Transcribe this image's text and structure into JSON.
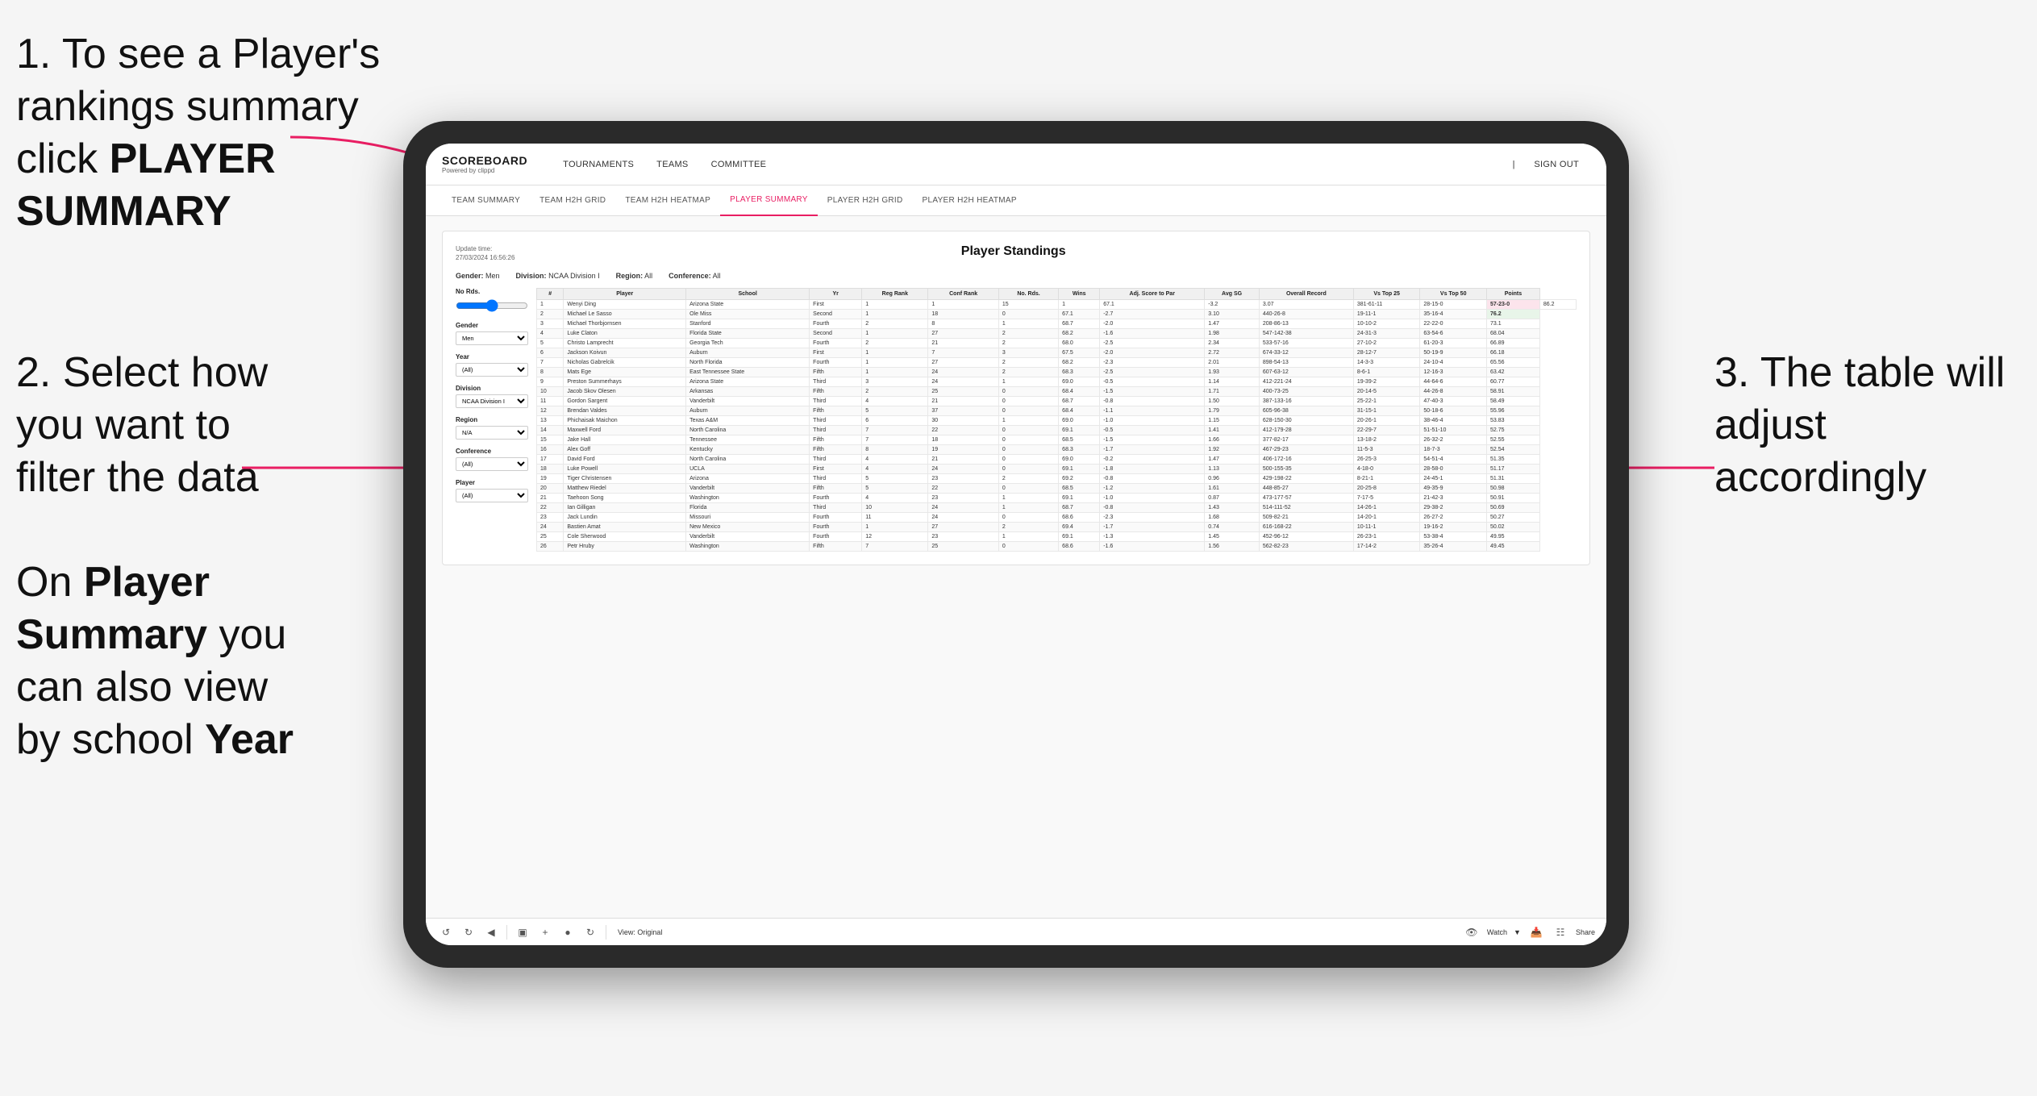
{
  "instructions": {
    "step1": "1. To see a Player's rankings summary click ",
    "step1_bold": "PLAYER SUMMARY",
    "step2_title": "2. Select how you want to filter the data",
    "step3_title": "3. The table will adjust accordingly",
    "bottom_note": "On ",
    "bottom_bold1": "Player Summary",
    "bottom_mid": " you can also view by school ",
    "bottom_bold2": "Year"
  },
  "nav": {
    "logo": "SCOREBOARD",
    "logo_sub": "Powered by clippd",
    "items": [
      "TOURNAMENTS",
      "TEAMS",
      "COMMITTEE"
    ],
    "right": [
      "Sign out"
    ]
  },
  "sub_nav": {
    "items": [
      "TEAM SUMMARY",
      "TEAM H2H GRID",
      "TEAM H2H HEATMAP",
      "PLAYER SUMMARY",
      "PLAYER H2H GRID",
      "PLAYER H2H HEATMAP"
    ]
  },
  "card": {
    "title": "Player Standings",
    "update_label": "Update time:",
    "update_value": "27/03/2024 16:56:26",
    "filters": {
      "gender_label": "Gender:",
      "gender_value": "Men",
      "division_label": "Division:",
      "division_value": "NCAA Division I",
      "region_label": "Region:",
      "region_value": "All",
      "conference_label": "Conference:",
      "conference_value": "All"
    }
  },
  "sidebar": {
    "no_rds_label": "No Rds.",
    "gender_label": "Gender",
    "gender_value": "Men",
    "year_label": "Year",
    "year_value": "(All)",
    "division_label": "Division",
    "division_value": "NCAA Division I",
    "region_label": "Region",
    "region_value": "N/A",
    "conference_label": "Conference",
    "conference_value": "(All)",
    "player_label": "Player",
    "player_value": "(All)"
  },
  "table": {
    "headers": [
      "#",
      "Player",
      "School",
      "Yr",
      "Reg Rank",
      "Conf Rank",
      "No. Rds.",
      "Wins",
      "Adj. Score to Par",
      "Avg SG",
      "Overall Record",
      "Vs Top 25",
      "Vs Top 50",
      "Points"
    ],
    "rows": [
      [
        "1",
        "Wenyi Ding",
        "Arizona State",
        "First",
        "1",
        "1",
        "15",
        "1",
        "67.1",
        "-3.2",
        "3.07",
        "381-61-11",
        "28-15-0",
        "57-23-0",
        "86.2"
      ],
      [
        "2",
        "Michael Le Sasso",
        "Ole Miss",
        "Second",
        "1",
        "18",
        "0",
        "67.1",
        "-2.7",
        "3.10",
        "440-26-8",
        "19-11-1",
        "35-16-4",
        "76.2"
      ],
      [
        "3",
        "Michael Thorbjornsen",
        "Stanford",
        "Fourth",
        "2",
        "8",
        "1",
        "68.7",
        "-2.0",
        "1.47",
        "208-86-13",
        "10-10-2",
        "22-22-0",
        "73.1"
      ],
      [
        "4",
        "Luke Claton",
        "Florida State",
        "Second",
        "1",
        "27",
        "2",
        "68.2",
        "-1.6",
        "1.98",
        "547-142-38",
        "24-31-3",
        "63-54-6",
        "68.04"
      ],
      [
        "5",
        "Christo Lamprecht",
        "Georgia Tech",
        "Fourth",
        "2",
        "21",
        "2",
        "68.0",
        "-2.5",
        "2.34",
        "533-57-16",
        "27-10-2",
        "61-20-3",
        "66.89"
      ],
      [
        "6",
        "Jackson Koivun",
        "Auburn",
        "First",
        "1",
        "7",
        "3",
        "67.5",
        "-2.0",
        "2.72",
        "674-33-12",
        "28-12-7",
        "50-19-9",
        "66.18"
      ],
      [
        "7",
        "Nicholas Gabrelcik",
        "North Florida",
        "Fourth",
        "1",
        "27",
        "2",
        "68.2",
        "-2.3",
        "2.01",
        "898-54-13",
        "14-3-3",
        "24-10-4",
        "65.56"
      ],
      [
        "8",
        "Mats Ege",
        "East Tennessee State",
        "Fifth",
        "1",
        "24",
        "2",
        "68.3",
        "-2.5",
        "1.93",
        "607-63-12",
        "8-6-1",
        "12-16-3",
        "63.42"
      ],
      [
        "9",
        "Preston Summerhays",
        "Arizona State",
        "Third",
        "3",
        "24",
        "1",
        "69.0",
        "-0.5",
        "1.14",
        "412-221-24",
        "19-39-2",
        "44-64-6",
        "60.77"
      ],
      [
        "10",
        "Jacob Skov Olesen",
        "Arkansas",
        "Fifth",
        "2",
        "25",
        "0",
        "68.4",
        "-1.5",
        "1.71",
        "400-73-25",
        "20-14-5",
        "44-26-8",
        "58.91"
      ],
      [
        "11",
        "Gordon Sargent",
        "Vanderbilt",
        "Third",
        "4",
        "21",
        "0",
        "68.7",
        "-0.8",
        "1.50",
        "387-133-16",
        "25-22-1",
        "47-40-3",
        "58.49"
      ],
      [
        "12",
        "Brendan Valdes",
        "Auburn",
        "Fifth",
        "5",
        "37",
        "0",
        "68.4",
        "-1.1",
        "1.79",
        "605-96-38",
        "31-15-1",
        "50-18-6",
        "55.96"
      ],
      [
        "13",
        "Phichaisak Maichon",
        "Texas A&M",
        "Third",
        "6",
        "30",
        "1",
        "69.0",
        "-1.0",
        "1.15",
        "628-150-30",
        "20-26-1",
        "38-46-4",
        "53.83"
      ],
      [
        "14",
        "Maxwell Ford",
        "North Carolina",
        "Third",
        "7",
        "22",
        "0",
        "69.1",
        "-0.5",
        "1.41",
        "412-179-28",
        "22-29-7",
        "51-51-10",
        "52.75"
      ],
      [
        "15",
        "Jake Hall",
        "Tennessee",
        "Fifth",
        "7",
        "18",
        "0",
        "68.5",
        "-1.5",
        "1.66",
        "377-82-17",
        "13-18-2",
        "26-32-2",
        "52.55"
      ],
      [
        "16",
        "Alex Goff",
        "Kentucky",
        "Fifth",
        "8",
        "19",
        "0",
        "68.3",
        "-1.7",
        "1.92",
        "467-29-23",
        "11-5-3",
        "18-7-3",
        "52.54"
      ],
      [
        "17",
        "David Ford",
        "North Carolina",
        "Third",
        "4",
        "21",
        "0",
        "69.0",
        "-0.2",
        "1.47",
        "406-172-16",
        "26-25-3",
        "54-51-4",
        "51.35"
      ],
      [
        "18",
        "Luke Powell",
        "UCLA",
        "First",
        "4",
        "24",
        "0",
        "69.1",
        "-1.8",
        "1.13",
        "500-155-35",
        "4-18-0",
        "28-58-0",
        "51.17"
      ],
      [
        "19",
        "Tiger Christensen",
        "Arizona",
        "Third",
        "5",
        "23",
        "2",
        "69.2",
        "-0.8",
        "0.96",
        "429-198-22",
        "8-21-1",
        "24-45-1",
        "51.31"
      ],
      [
        "20",
        "Matthew Riedel",
        "Vanderbilt",
        "Fifth",
        "5",
        "22",
        "0",
        "68.5",
        "-1.2",
        "1.61",
        "448-85-27",
        "20-25-8",
        "49-35-9",
        "50.98"
      ],
      [
        "21",
        "Taehoon Song",
        "Washington",
        "Fourth",
        "4",
        "23",
        "1",
        "69.1",
        "-1.0",
        "0.87",
        "473-177-57",
        "7-17-5",
        "21-42-3",
        "50.91"
      ],
      [
        "22",
        "Ian Gilligan",
        "Florida",
        "Third",
        "10",
        "24",
        "1",
        "68.7",
        "-0.8",
        "1.43",
        "514-111-52",
        "14-26-1",
        "29-38-2",
        "50.69"
      ],
      [
        "23",
        "Jack Lundin",
        "Missouri",
        "Fourth",
        "11",
        "24",
        "0",
        "68.6",
        "-2.3",
        "1.68",
        "509-82-21",
        "14-20-1",
        "26-27-2",
        "50.27"
      ],
      [
        "24",
        "Bastien Amat",
        "New Mexico",
        "Fourth",
        "1",
        "27",
        "2",
        "69.4",
        "-1.7",
        "0.74",
        "616-168-22",
        "10-11-1",
        "19-16-2",
        "50.02"
      ],
      [
        "25",
        "Cole Sherwood",
        "Vanderbilt",
        "Fourth",
        "12",
        "23",
        "1",
        "69.1",
        "-1.3",
        "1.45",
        "452-96-12",
        "26-23-1",
        "53-38-4",
        "49.95"
      ],
      [
        "26",
        "Petr Hruby",
        "Washington",
        "Fifth",
        "7",
        "25",
        "0",
        "68.6",
        "-1.6",
        "1.56",
        "562-82-23",
        "17-14-2",
        "35-26-4",
        "49.45"
      ]
    ]
  },
  "toolbar": {
    "view_label": "View: Original",
    "watch_label": "Watch",
    "share_label": "Share"
  }
}
